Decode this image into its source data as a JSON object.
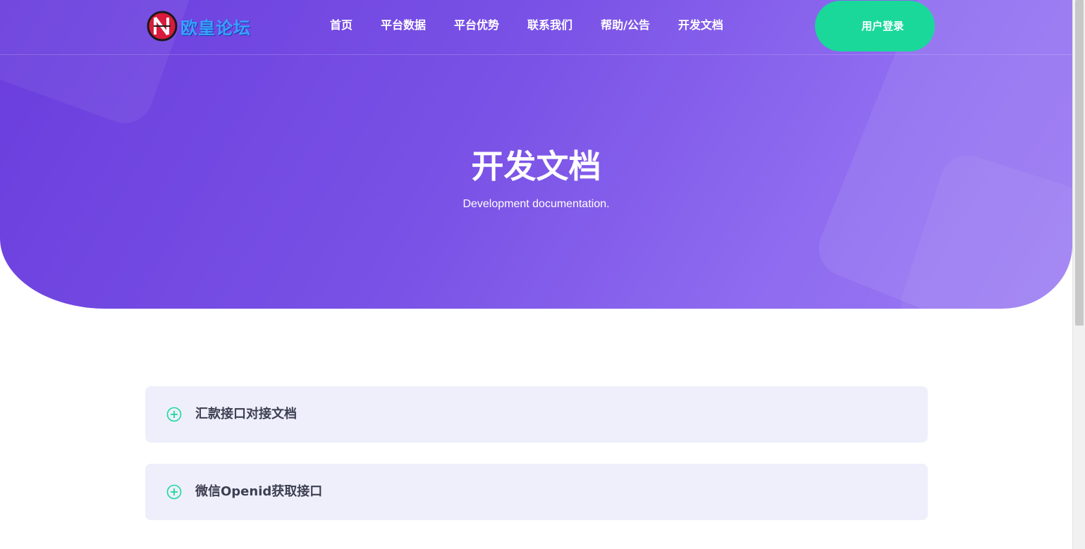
{
  "header": {
    "logo_text": "欧皇论坛",
    "nav": [
      "首页",
      "平台数据",
      "平台优势",
      "联系我们",
      "帮助/公告",
      "开发文档"
    ],
    "login_label": "用户登录"
  },
  "hero": {
    "title": "开发文档",
    "subtitle": "Development documentation."
  },
  "faq": {
    "items": [
      {
        "label": "汇款接口对接文档",
        "icon": "plus-circle-icon"
      },
      {
        "label": "微信Openid获取接口",
        "icon": "plus-circle-icon"
      }
    ]
  },
  "colors": {
    "hero_start": "#6a3ddd",
    "hero_end": "#9a7af2",
    "accent": "#19d89a",
    "card_bg": "#eeeffb",
    "logo_text": "#3aa0ff"
  }
}
